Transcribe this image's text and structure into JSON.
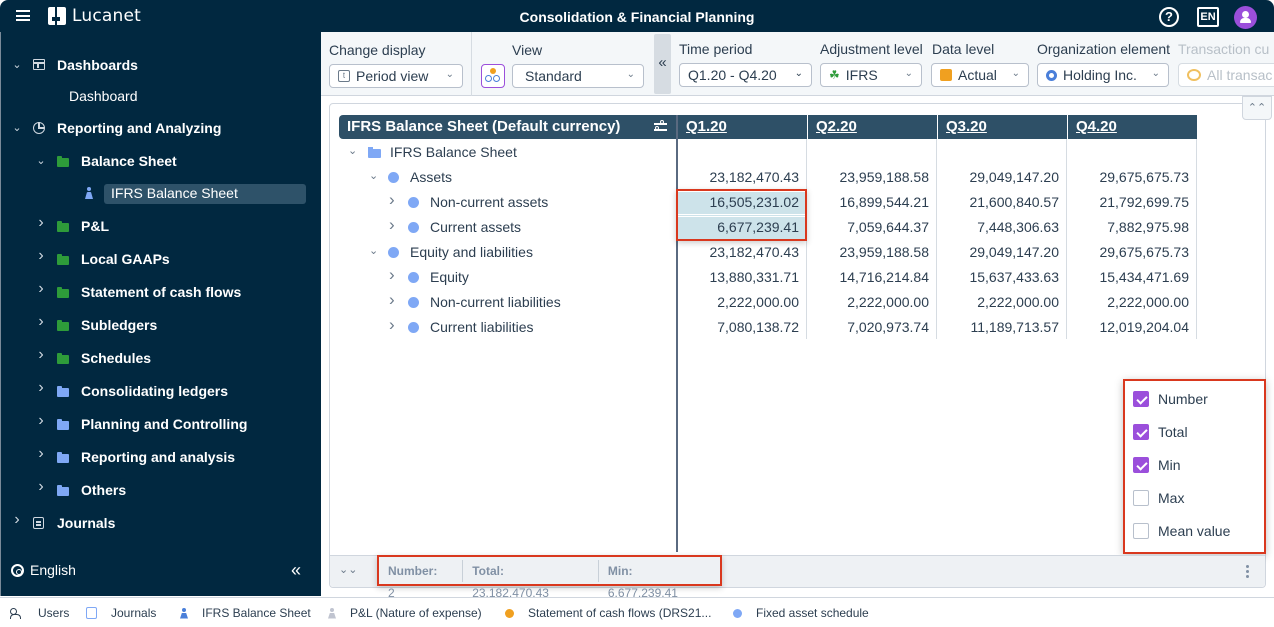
{
  "app": {
    "brand": "Lucanet",
    "title": "Consolidation & Financial Planning",
    "language_badge": "EN",
    "help_icon": "?"
  },
  "sidebar": {
    "items": [
      {
        "label": "Dashboards",
        "level": 0,
        "expanded": true,
        "icon": "dashboard-icon"
      },
      {
        "label": "Dashboard",
        "level": 1,
        "icon": "none"
      },
      {
        "label": "Reporting and Analyzing",
        "level": 0,
        "expanded": true,
        "icon": "pie-chart-icon"
      },
      {
        "label": "Balance Sheet",
        "level": 1,
        "expanded": true,
        "icon": "folder-green-icon"
      },
      {
        "label": "IFRS Balance Sheet",
        "level": 2,
        "active": true,
        "icon": "report-person-icon"
      },
      {
        "label": "P&L",
        "level": 1,
        "expanded": false,
        "icon": "folder-green-icon"
      },
      {
        "label": "Local GAAPs",
        "level": 1,
        "expanded": false,
        "icon": "folder-green-icon"
      },
      {
        "label": "Statement of cash flows",
        "level": 1,
        "expanded": false,
        "icon": "folder-green-icon"
      },
      {
        "label": "Subledgers",
        "level": 1,
        "expanded": false,
        "icon": "folder-green-icon"
      },
      {
        "label": "Schedules",
        "level": 1,
        "expanded": false,
        "icon": "folder-green-icon"
      },
      {
        "label": "Consolidating ledgers",
        "level": 1,
        "expanded": false,
        "icon": "folder-blue-icon"
      },
      {
        "label": "Planning and Controlling",
        "level": 1,
        "expanded": false,
        "icon": "folder-blue-icon"
      },
      {
        "label": "Reporting and analysis",
        "level": 1,
        "expanded": false,
        "icon": "folder-blue-icon"
      },
      {
        "label": "Others",
        "level": 1,
        "expanded": false,
        "icon": "folder-blue-icon"
      },
      {
        "label": "Journals",
        "level": 0,
        "expanded": false,
        "icon": "journal-icon"
      }
    ],
    "language": "English",
    "collapse_label": "«"
  },
  "toolbar": {
    "change_display": {
      "label": "Change display",
      "value": "Period view"
    },
    "view": {
      "label": "View",
      "value": "Standard"
    },
    "collapse_label": "«",
    "time_period": {
      "label": "Time period",
      "value": "Q1.20 - Q4.20"
    },
    "adjustment_level": {
      "label": "Adjustment level",
      "value": "IFRS"
    },
    "data_level": {
      "label": "Data level",
      "value": "Actual"
    },
    "organization_element": {
      "label": "Organization element",
      "value": "Holding Inc."
    },
    "transaction_currency": {
      "label": "Transaction cu",
      "value": "All transac"
    }
  },
  "grid": {
    "title": "IFRS Balance Sheet (Default currency)",
    "columns": [
      "Q1.20",
      "Q2.20",
      "Q3.20",
      "Q4.20"
    ],
    "rows": [
      {
        "label": "IFRS Balance Sheet",
        "indent": 0,
        "chevron": "down",
        "icon": "folder",
        "values": [
          "",
          "",
          "",
          ""
        ]
      },
      {
        "label": "Assets",
        "indent": 1,
        "chevron": "down",
        "icon": "dot",
        "values": [
          "23,182,470.43",
          "23,959,188.58",
          "29,049,147.20",
          "29,675,675.73"
        ]
      },
      {
        "label": "Non-current assets",
        "indent": 2,
        "chevron": "right",
        "icon": "dot",
        "values": [
          "16,505,231.02",
          "16,899,544.21",
          "21,600,840.57",
          "21,792,699.75"
        ],
        "selected_cols": [
          0
        ]
      },
      {
        "label": "Current assets",
        "indent": 2,
        "chevron": "right",
        "icon": "dot",
        "values": [
          "6,677,239.41",
          "7,059,644.37",
          "7,448,306.63",
          "7,882,975.98"
        ],
        "selected_cols": [
          0
        ]
      },
      {
        "label": "Equity and liabilities",
        "indent": 1,
        "chevron": "down",
        "icon": "dot",
        "values": [
          "23,182,470.43",
          "23,959,188.58",
          "29,049,147.20",
          "29,675,675.73"
        ]
      },
      {
        "label": "Equity",
        "indent": 2,
        "chevron": "right",
        "icon": "dot",
        "values": [
          "13,880,331.71",
          "14,716,214.84",
          "15,637,433.63",
          "15,434,471.69"
        ]
      },
      {
        "label": "Non-current liabilities",
        "indent": 2,
        "chevron": "right",
        "icon": "dot",
        "values": [
          "2,222,000.00",
          "2,222,000.00",
          "2,222,000.00",
          "2,222,000.00"
        ]
      },
      {
        "label": "Current liabilities",
        "indent": 2,
        "chevron": "right",
        "icon": "dot",
        "values": [
          "7,080,138.72",
          "7,020,973.74",
          "11,189,713.57",
          "12,019,204.04"
        ]
      }
    ]
  },
  "stats_menu": {
    "options": [
      {
        "label": "Number",
        "checked": true
      },
      {
        "label": "Total",
        "checked": true
      },
      {
        "label": "Min",
        "checked": true
      },
      {
        "label": "Max",
        "checked": false
      },
      {
        "label": "Mean value",
        "checked": false
      }
    ]
  },
  "statusbar": {
    "stats": [
      {
        "key": "Number:",
        "value": "2"
      },
      {
        "key": "Total:",
        "value": "23.182.470,43"
      },
      {
        "key": "Min:",
        "value": "6.677.239,41"
      }
    ]
  },
  "taskbar": {
    "items": [
      {
        "label": "Users",
        "icon": "users-icon"
      },
      {
        "label": "Journals",
        "icon": "journal-icon",
        "color": "#7fa8f5"
      },
      {
        "label": "IFRS Balance Sheet",
        "icon": "report-person-icon",
        "color": "#4a7fd9"
      },
      {
        "label": "P&L (Nature of expense)",
        "icon": "report-person-icon",
        "color": "#c0c4d0"
      },
      {
        "label": "Statement of cash flows (DRS21...",
        "icon": "dot-icon",
        "color": "#f0a020"
      },
      {
        "label": "Fixed asset schedule",
        "icon": "dot-icon",
        "color": "#7fa8f5"
      }
    ]
  },
  "colors": {
    "header_bg": "#012840",
    "grid_header_bg": "#2e5067",
    "accent_purple": "#9b4fdb",
    "selection_fill": "#cde3ea",
    "highlight_red": "#d9381e"
  }
}
